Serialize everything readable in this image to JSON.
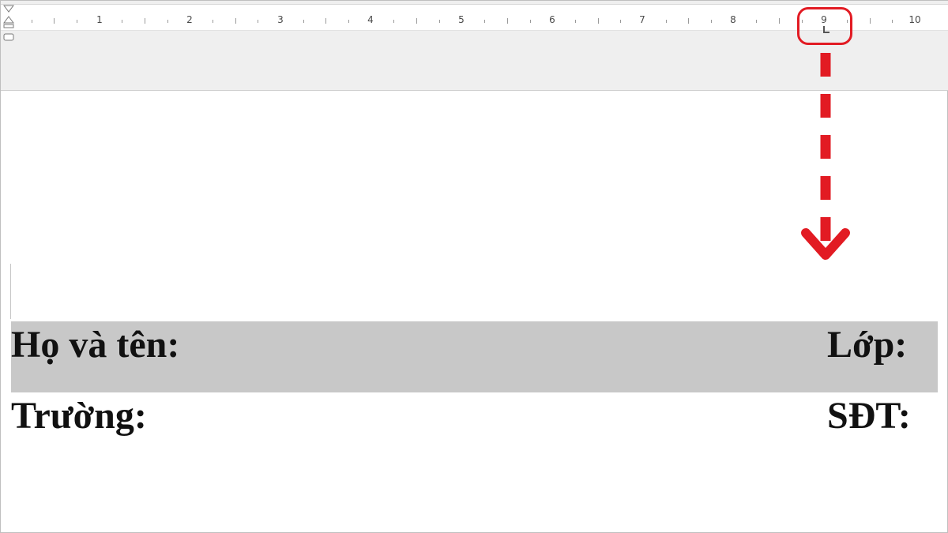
{
  "ruler": {
    "numbers": [
      "1",
      "2",
      "3",
      "4",
      "5",
      "6",
      "7",
      "8",
      "9",
      "10"
    ],
    "tab_stop_type": "left-tab-icon"
  },
  "annotation": {
    "color": "#e21b23",
    "highlight": "circle-around-tab-stop",
    "arrow": "dashed-arrow-down"
  },
  "document": {
    "row1": {
      "left_label": "Họ và tên:",
      "right_label": "Lớp:",
      "shading": "#c8c8c8"
    },
    "row2": {
      "left_label": "Trường:",
      "right_label": "SĐT:"
    }
  }
}
